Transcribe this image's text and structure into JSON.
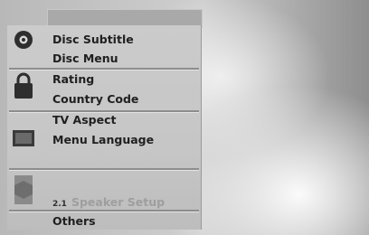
{
  "menu": {
    "disc": {
      "icon": "disc-icon",
      "items": [
        "Disc Subtitle",
        "Disc Menu"
      ]
    },
    "lock": {
      "icon": "padlock-icon",
      "items": [
        "Rating",
        "Country Code"
      ]
    },
    "tv": {
      "icon": "tv-screen-icon",
      "items": [
        "TV Aspect",
        "Menu Language"
      ]
    },
    "speaker": {
      "icon": "speaker-icon",
      "badge": "2.1",
      "items": [
        "Speaker Setup"
      ]
    },
    "others": {
      "items": [
        "Others"
      ]
    }
  },
  "colors": {
    "panel": "#c8c8c8",
    "text": "#202020",
    "disabled_text": "#9e9e9e"
  }
}
